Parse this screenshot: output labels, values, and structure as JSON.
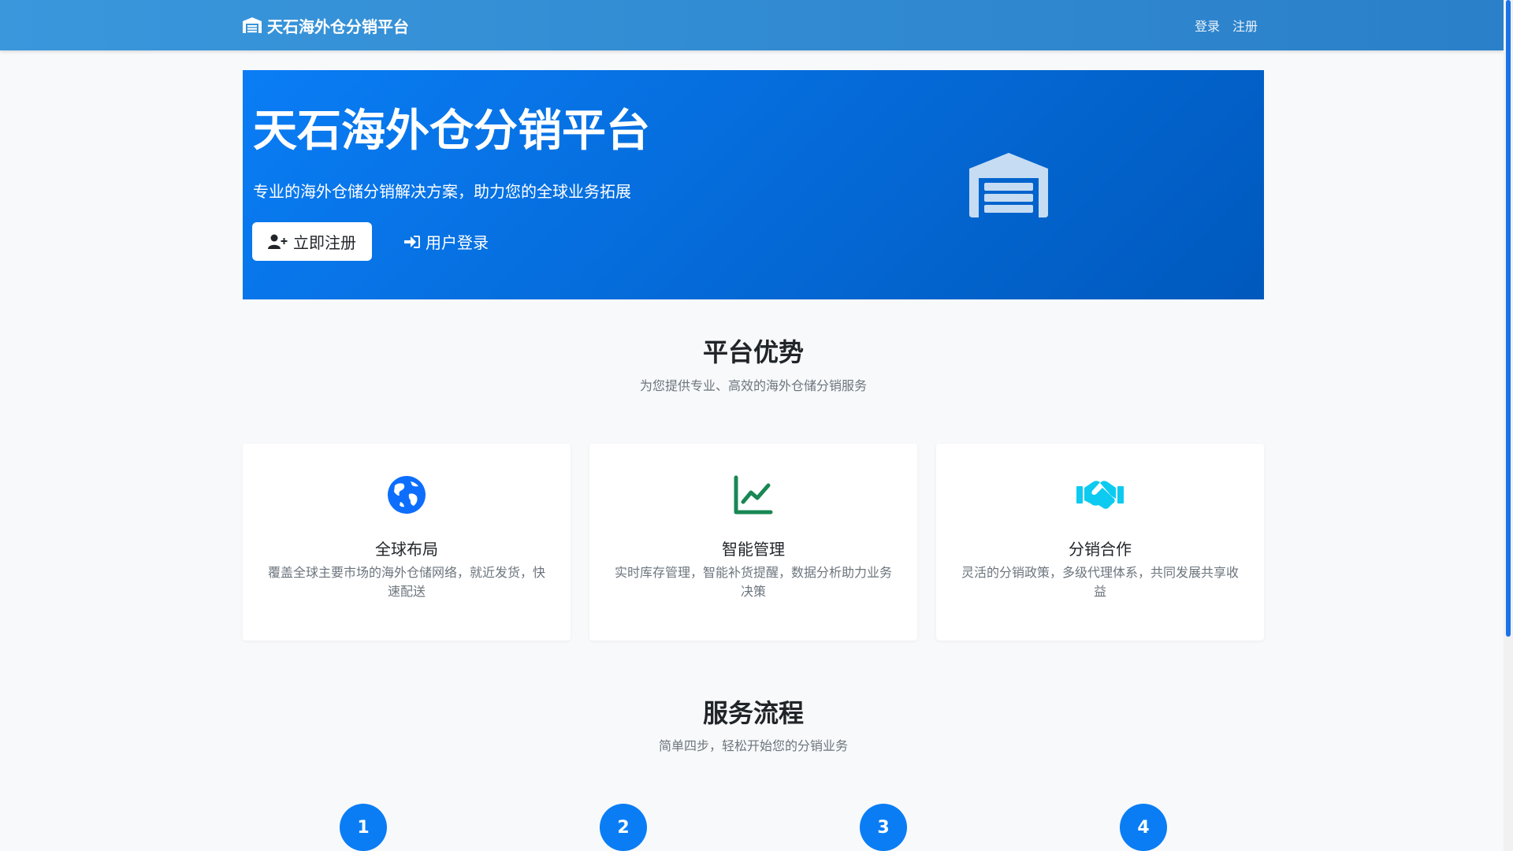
{
  "navbar": {
    "brand": "天石海外仓分销平台",
    "links": [
      "登录",
      "注册"
    ]
  },
  "hero": {
    "title": "天石海外仓分销平台",
    "subtitle": "专业的海外仓储分销解决方案，助力您的全球业务拓展",
    "register_label": "立即注册",
    "login_label": "用户登录"
  },
  "advantages": {
    "title": "平台优势",
    "subtitle": "为您提供专业、高效的海外仓储分销服务",
    "cards": [
      {
        "title": "全球布局",
        "desc": "覆盖全球主要市场的海外仓储网络，就近发货，快速配送",
        "icon": "globe-icon"
      },
      {
        "title": "智能管理",
        "desc": "实时库存管理，智能补货提醒，数据分析助力业务决策",
        "icon": "chart-line-icon"
      },
      {
        "title": "分销合作",
        "desc": "灵活的分销政策，多级代理体系，共同发展共享收益",
        "icon": "handshake-icon"
      }
    ]
  },
  "process": {
    "title": "服务流程",
    "subtitle": "简单四步，轻松开始您的分销业务",
    "steps": [
      "1",
      "2",
      "3",
      "4"
    ]
  },
  "colors": {
    "primary": "#0a7df5",
    "success": "#198754",
    "info": "#0dcaf0"
  }
}
